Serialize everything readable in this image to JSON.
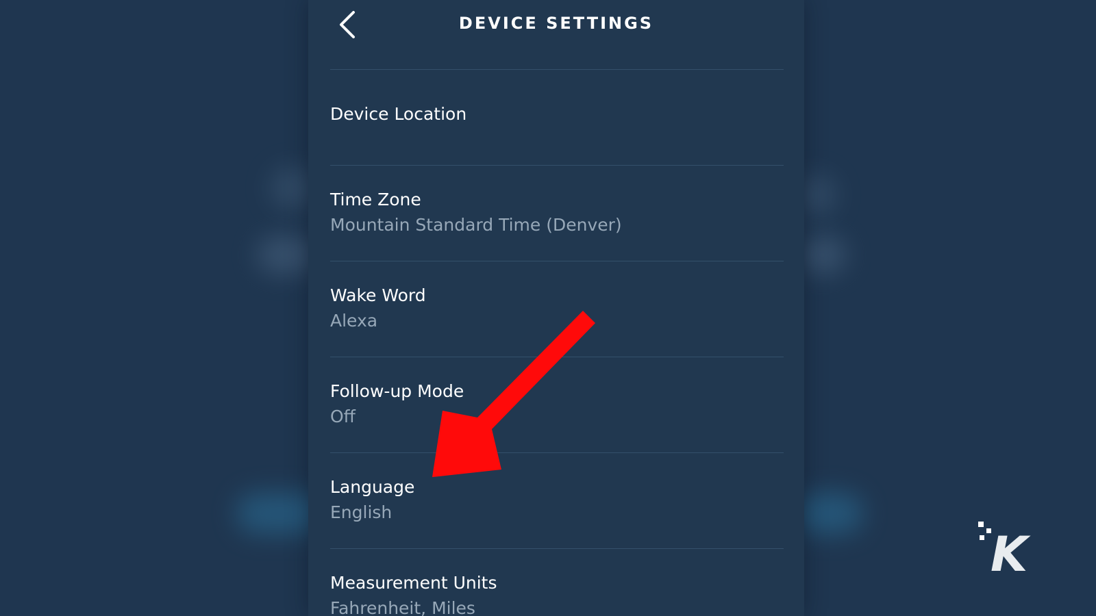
{
  "header": {
    "title": "DEVICE SETTINGS",
    "back_icon": "chevron-left-icon"
  },
  "settings": [
    {
      "label": "Device Location",
      "value": ""
    },
    {
      "label": "Time Zone",
      "value": "Mountain Standard Time (Denver)"
    },
    {
      "label": "Wake Word",
      "value": "Alexa"
    },
    {
      "label": "Follow-up Mode",
      "value": "Off"
    },
    {
      "label": "Language",
      "value": "English"
    },
    {
      "label": "Measurement Units",
      "value": "Fahrenheit, Miles"
    }
  ],
  "annotation": {
    "arrow_color": "#ff0a0a",
    "arrow_icon": "red-arrow-icon"
  },
  "colors": {
    "panel_background": "#213850",
    "page_background": "#1f3650",
    "label_text": "#ffffff",
    "value_text": "#97a8b8",
    "divider": "#34506b"
  },
  "watermark": {
    "logo_icon": "k-logo-icon",
    "text": "K"
  }
}
